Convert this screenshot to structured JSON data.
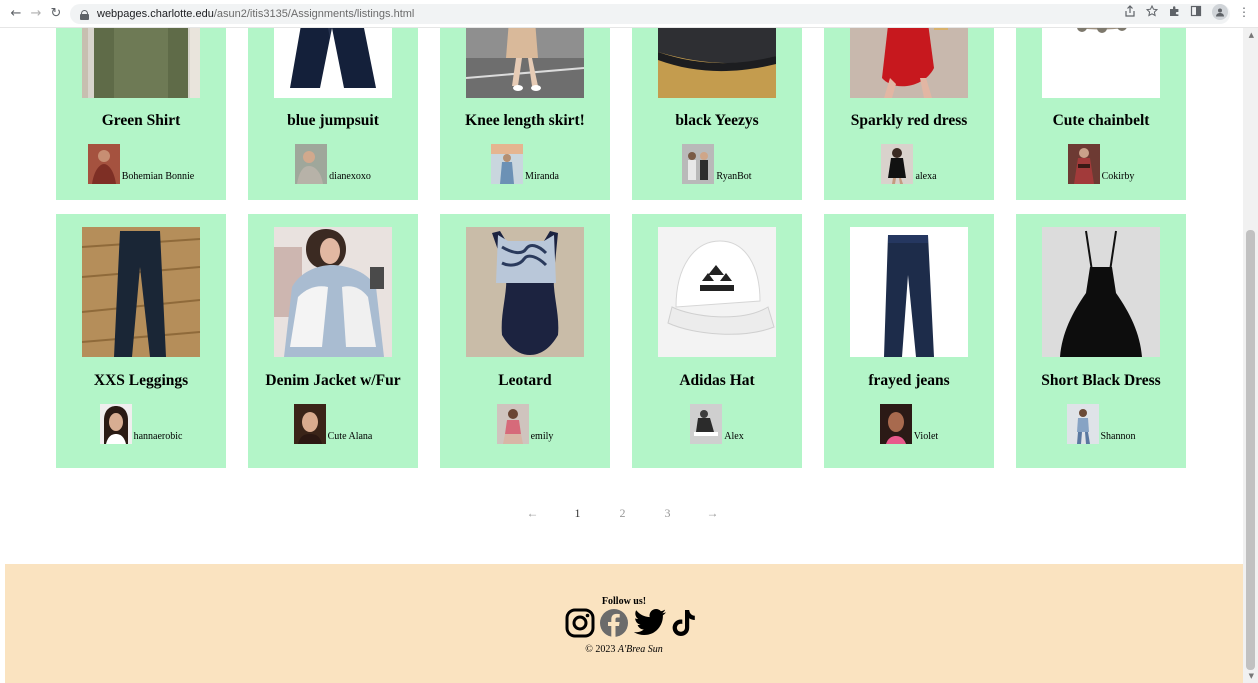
{
  "browser": {
    "url_host": "webpages.charlotte.edu",
    "url_path": "/asun2/itis3135/Assignments/listings.html",
    "back_glyph": "←",
    "forward_glyph": "→",
    "reload_glyph": "↻",
    "menu_glyph": "⋮"
  },
  "listings_row1": [
    {
      "title": "Green Shirt",
      "seller": "Bohemian Bonnie"
    },
    {
      "title": "blue jumpsuit",
      "seller": "dianexoxo"
    },
    {
      "title": "Knee length skirt!",
      "seller": "Miranda"
    },
    {
      "title": "black Yeezys",
      "seller": "RyanBot"
    },
    {
      "title": "Sparkly red dress",
      "seller": "alexa"
    },
    {
      "title": "Cute chainbelt",
      "seller": "Cokirby"
    }
  ],
  "listings_row2": [
    {
      "title": "XXS Leggings",
      "seller": "hannaerobic"
    },
    {
      "title": "Denim Jacket w/Fur",
      "seller": "Cute Alana"
    },
    {
      "title": "Leotard",
      "seller": "emily"
    },
    {
      "title": "Adidas Hat",
      "seller": "Alex"
    },
    {
      "title": "frayed jeans",
      "seller": "Violet"
    },
    {
      "title": "Short Black Dress",
      "seller": "Shannon"
    }
  ],
  "pagination": {
    "prev": "←",
    "pages": [
      "1",
      "2",
      "3"
    ],
    "next": "→",
    "current": "1"
  },
  "footer": {
    "follow": "Follow us!",
    "copyright": "© 2023",
    "author": "A'Brea Sun"
  },
  "colors": {
    "card_bg": "#b3f5c8",
    "footer_bg": "#fae3c0"
  }
}
